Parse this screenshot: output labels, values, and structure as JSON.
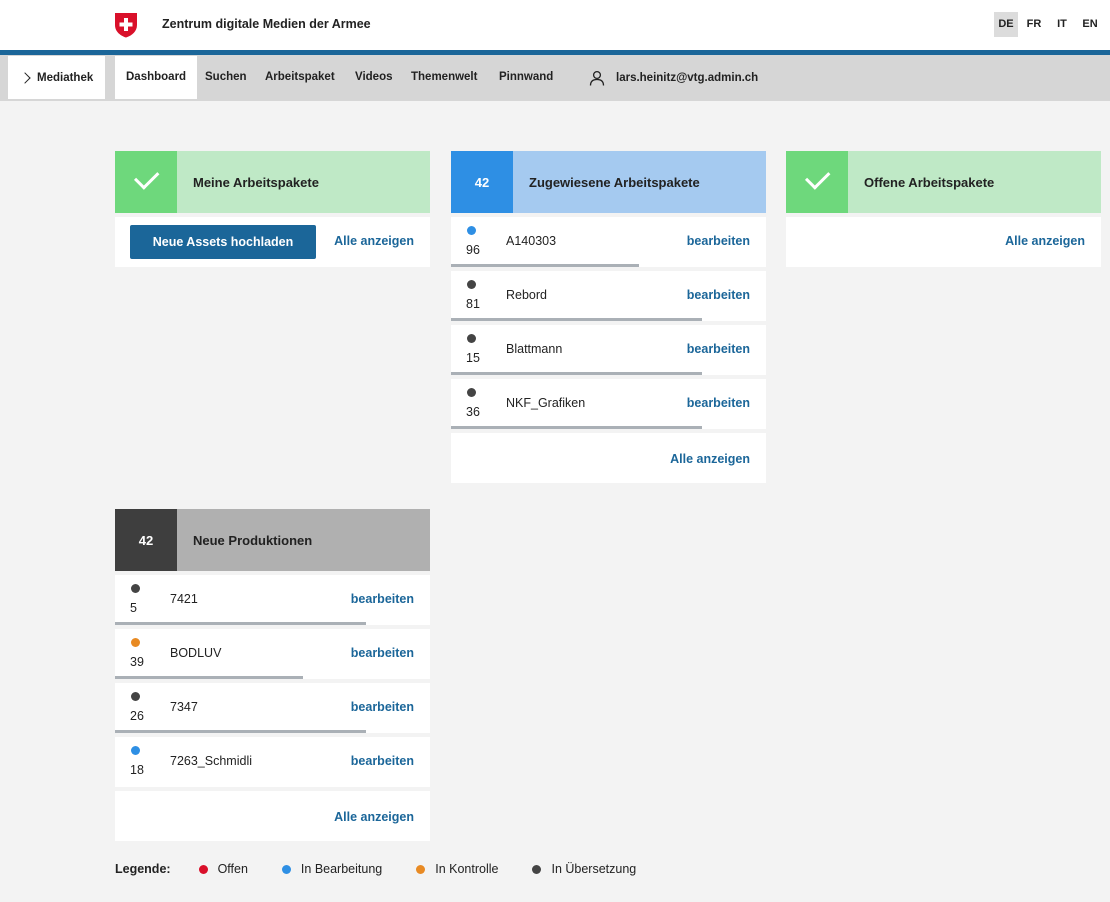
{
  "header": {
    "site_title": "Zentrum digitale Medien der Armee",
    "languages": [
      {
        "code": "DE",
        "active": true
      },
      {
        "code": "FR",
        "active": false
      },
      {
        "code": "IT",
        "active": false
      },
      {
        "code": "EN",
        "active": false
      }
    ]
  },
  "nav": {
    "mediathek": "Mediathek",
    "items": [
      "Dashboard",
      "Suchen",
      "Arbeitspaket",
      "Videos",
      "Themenwelt",
      "Pinnwand"
    ],
    "active_item": "Dashboard",
    "user_email": "lars.heinitz@vtg.admin.ch"
  },
  "colors": {
    "accent": "#1b6699",
    "offen": "#d9102a",
    "in_bearbeitung": "#2e8fe4",
    "in_kontrolle": "#e88a23",
    "in_uebersetzung": "#444444"
  },
  "cards": {
    "meine": {
      "title": "Meine Arbeitspakete",
      "icon": "check-icon",
      "upload_button": "Neue Assets hochladen",
      "show_all": "Alle anzeigen"
    },
    "zugewiesene": {
      "count": "42",
      "title": "Zugewiesene Arbeitspakete",
      "show_all": "Alle anzeigen",
      "rows": [
        {
          "count": "96",
          "name": "A140303",
          "action": "bearbeiten",
          "status": "in_bearbeitung",
          "progress": 0.6
        },
        {
          "count": "81",
          "name": "Rebord",
          "action": "bearbeiten",
          "status": "in_uebersetzung",
          "progress": 0.8
        },
        {
          "count": "15",
          "name": "Blattmann",
          "action": "bearbeiten",
          "status": "in_uebersetzung",
          "progress": 0.8
        },
        {
          "count": "36",
          "name": "NKF_Grafiken",
          "action": "bearbeiten",
          "status": "in_uebersetzung",
          "progress": 0.8
        }
      ]
    },
    "offene": {
      "title": "Offene Arbeitspakete",
      "icon": "check-icon",
      "show_all": "Alle anzeigen"
    },
    "produktionen": {
      "count": "42",
      "title": "Neue Produktionen",
      "show_all": "Alle anzeigen",
      "rows": [
        {
          "count": "5",
          "name": "7421",
          "action": "bearbeiten",
          "status": "in_uebersetzung",
          "progress": 0.8
        },
        {
          "count": "39",
          "name": "BODLUV",
          "action": "bearbeiten",
          "status": "in_kontrolle",
          "progress": 0.6
        },
        {
          "count": "26",
          "name": "7347",
          "action": "bearbeiten",
          "status": "in_uebersetzung",
          "progress": 0.8
        },
        {
          "count": "18",
          "name": "7263_Schmidli",
          "action": "bearbeiten",
          "status": "in_bearbeitung",
          "progress": 0
        }
      ]
    }
  },
  "legend": {
    "label": "Legende:",
    "items": [
      {
        "key": "offen",
        "label": "Offen"
      },
      {
        "key": "in_bearbeitung",
        "label": "In Bearbeitung"
      },
      {
        "key": "in_kontrolle",
        "label": "In Kontrolle"
      },
      {
        "key": "in_uebersetzung",
        "label": "In Übersetzung"
      }
    ]
  }
}
